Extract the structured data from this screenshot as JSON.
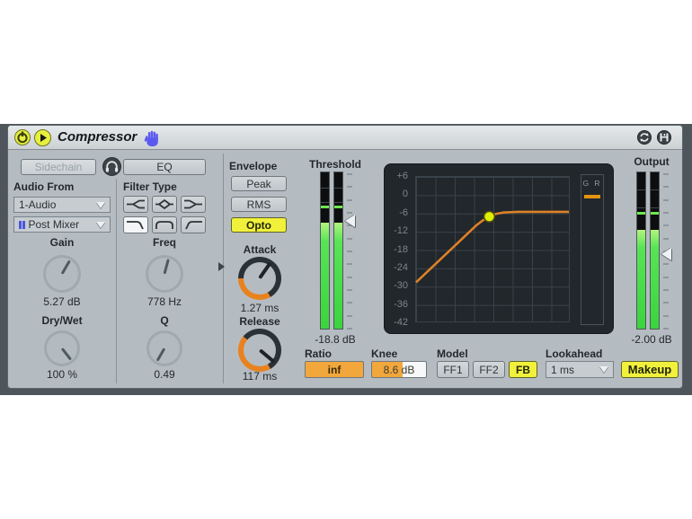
{
  "titlebar": {
    "title": "Compressor"
  },
  "sidechain": {
    "button": "Sidechain",
    "eq_button": "EQ",
    "audio_from_label": "Audio From",
    "source_value": "1-Audio",
    "tap_value": "Post Mixer",
    "gain_label": "Gain",
    "gain_value": "5.27 dB",
    "drywet_label": "Dry/Wet",
    "drywet_value": "100 %"
  },
  "filter": {
    "label": "Filter Type",
    "freq_label": "Freq",
    "freq_value": "778 Hz",
    "q_label": "Q",
    "q_value": "0.49"
  },
  "envelope": {
    "label": "Envelope",
    "peak": "Peak",
    "rms": "RMS",
    "opto": "Opto",
    "selected_mode": "Opto",
    "attack_label": "Attack",
    "attack_value": "1.27 ms",
    "release_label": "Release",
    "release_value": "117 ms"
  },
  "threshold": {
    "label": "Threshold",
    "value": "-18.8 dB",
    "meter": {
      "black_pct": 32,
      "peak_pct": 21,
      "marker_pct": 31,
      "ticks": 13
    }
  },
  "output": {
    "label": "Output",
    "value": "-2.00 dB",
    "meter": {
      "black_pct": 37,
      "peak_pct": 25,
      "marker_pct": 52,
      "ticks": 13
    }
  },
  "graph": {
    "y_ticks": [
      "+6",
      "0",
      "-6",
      "-12",
      "-18",
      "-24",
      "-30",
      "-36",
      "-42"
    ],
    "x_range": [
      -42,
      6
    ],
    "y_range": [
      -42,
      6
    ],
    "curve": [
      [
        -42,
        -29
      ],
      [
        -23.1,
        -10.1
      ],
      [
        -21,
        -8.4
      ],
      [
        -19,
        -7.2
      ],
      [
        -17,
        -6.3
      ],
      [
        -14.5,
        -5.8
      ],
      [
        -10,
        -5.6
      ],
      [
        6,
        -5.6
      ]
    ],
    "dot": [
      -19,
      -7.2
    ],
    "gr_label": "G R",
    "curve_color": "#e08127",
    "dot_color": "#ddf005"
  },
  "controls": {
    "ratio_label": "Ratio",
    "ratio_value": "inf",
    "knee_label": "Knee",
    "knee_value": "8.6 dB",
    "model_label": "Model",
    "model_ff1": "FF1",
    "model_ff2": "FF2",
    "model_fb": "FB",
    "model_selected": "FB",
    "lookahead_label": "Lookahead",
    "lookahead_value": "1 ms",
    "makeup_button": "Makeup"
  },
  "colors": {
    "accent_yellow": "#f1f13c",
    "accent_orange": "#f2a73d",
    "curve_orange": "#e08127",
    "meter_green": "#3ad43e",
    "graph_bg": "#21272b",
    "device_bg": "#b5bcc1"
  }
}
